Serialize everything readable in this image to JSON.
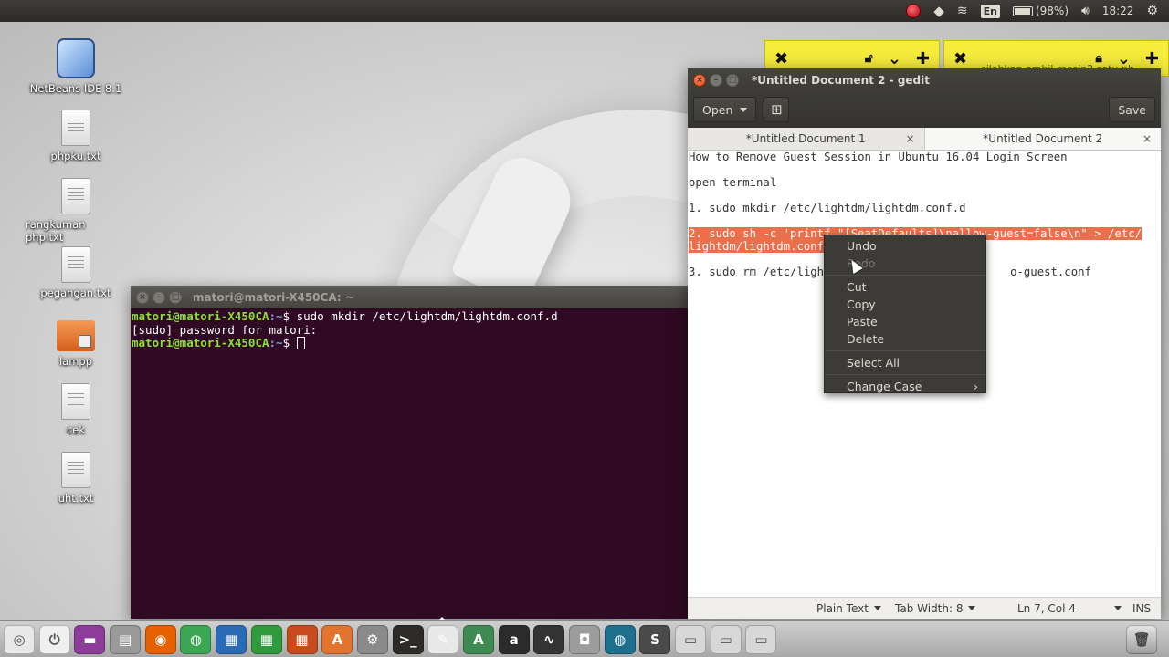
{
  "top_panel": {
    "battery": "(98%)",
    "time": "18:22",
    "keyboard": "En"
  },
  "desktop_icons": [
    {
      "label": "NetBeans IDE 8.1",
      "type": "cube"
    },
    {
      "label": "phpku.txt",
      "type": "file"
    },
    {
      "label": "rangkuman php.txt",
      "type": "file"
    },
    {
      "label": "pegangan.txt",
      "type": "file"
    },
    {
      "label": "lampp",
      "type": "folder"
    },
    {
      "label": "cek",
      "type": "file"
    },
    {
      "label": "uht.txt",
      "type": "file"
    }
  ],
  "sticky_notes": [
    {
      "title": "silahkan ambil mesin2 satu ph..."
    }
  ],
  "terminal": {
    "title": "matori@matori-X450CA: ~",
    "lines": [
      {
        "user": "matori@matori-X450CA",
        "path": ":~",
        "cmd": "$ sudo mkdir /etc/lightdm/lightdm.conf.d"
      },
      {
        "text": "[sudo] password for matori:"
      },
      {
        "user": "matori@matori-X450CA",
        "path": ":~",
        "cmd": "$ "
      }
    ]
  },
  "gedit": {
    "title": "*Untitled Document 2 - gedit",
    "toolbar": {
      "open_label": "Open",
      "save_label": "Save"
    },
    "tabs": [
      {
        "label": "*Untitled Document 1"
      },
      {
        "label": "*Untitled Document 2"
      }
    ],
    "lines": {
      "l1": "How to Remove Guest Session in Ubuntu 16.04 Login Screen",
      "l3": "open terminal",
      "l5": "1. sudo mkdir /etc/lightdm/lightdm.conf.d",
      "l7_prefix": "2. ",
      "l7_sel": "sudo sh -c 'printf \"[SeatDefaults]\\nallow-guest=false\\n\" > /etc/",
      "l8_sel": "lightdm/lightdm.conf",
      "l10_start": "3. sudo rm /etc/ligh",
      "l10_end": "o-guest.conf"
    },
    "status": {
      "language": "Plain Text",
      "tab_width": "Tab Width: 8",
      "position": "Ln 7, Col 4",
      "mode": "INS"
    }
  },
  "context_menu": {
    "undo": "Undo",
    "redo": "Redo",
    "cut": "Cut",
    "copy": "Copy",
    "paste": "Paste",
    "delete": "Delete",
    "select_all": "Select All",
    "change_case": "Change Case"
  },
  "dock_items": [
    {
      "name": "dash-icon",
      "color": "#e8e8e8",
      "glyph": "◎"
    },
    {
      "name": "power-icon",
      "color": "#f0f0f0",
      "glyph": "⏻"
    },
    {
      "name": "app-purple-icon",
      "color": "#8e3c9c",
      "glyph": "▬"
    },
    {
      "name": "files-icon",
      "color": "#9a9a9a",
      "glyph": "▤"
    },
    {
      "name": "firefox-icon",
      "color": "#e66000",
      "glyph": "◉"
    },
    {
      "name": "chrome-icon",
      "color": "#3aa853",
      "glyph": "◍"
    },
    {
      "name": "writer-icon",
      "color": "#2a6bb8",
      "glyph": "▦"
    },
    {
      "name": "calc-icon",
      "color": "#2f9b3d",
      "glyph": "▦"
    },
    {
      "name": "impress-icon",
      "color": "#c84b1e",
      "glyph": "▦"
    },
    {
      "name": "software-center-icon",
      "color": "#e2742e",
      "glyph": "A"
    },
    {
      "name": "settings-icon",
      "color": "#8a8a8a",
      "glyph": "⚙"
    },
    {
      "name": "terminal-icon",
      "color": "#2c2b28",
      "glyph": ">_"
    },
    {
      "name": "text-editor-icon",
      "color": "#e8e8e8",
      "glyph": "✎"
    },
    {
      "name": "android-studio-icon",
      "color": "#3d8a52",
      "glyph": "A"
    },
    {
      "name": "amazon-icon",
      "color": "#2b2b2b",
      "glyph": "a"
    },
    {
      "name": "system-monitor-icon",
      "color": "#333",
      "glyph": "∿"
    },
    {
      "name": "screenshot-icon",
      "color": "#9c9c9c",
      "glyph": "◘"
    },
    {
      "name": "globe-icon",
      "color": "#1d6f8c",
      "glyph": "◍"
    },
    {
      "name": "sublime-icon",
      "color": "#4a4a4a",
      "glyph": "S"
    },
    {
      "name": "drive-1-icon",
      "color": "#d7d7d7",
      "glyph": "▭"
    },
    {
      "name": "drive-2-icon",
      "color": "#d7d7d7",
      "glyph": "▭"
    },
    {
      "name": "drive-3-icon",
      "color": "#d7d7d7",
      "glyph": "▭"
    }
  ]
}
